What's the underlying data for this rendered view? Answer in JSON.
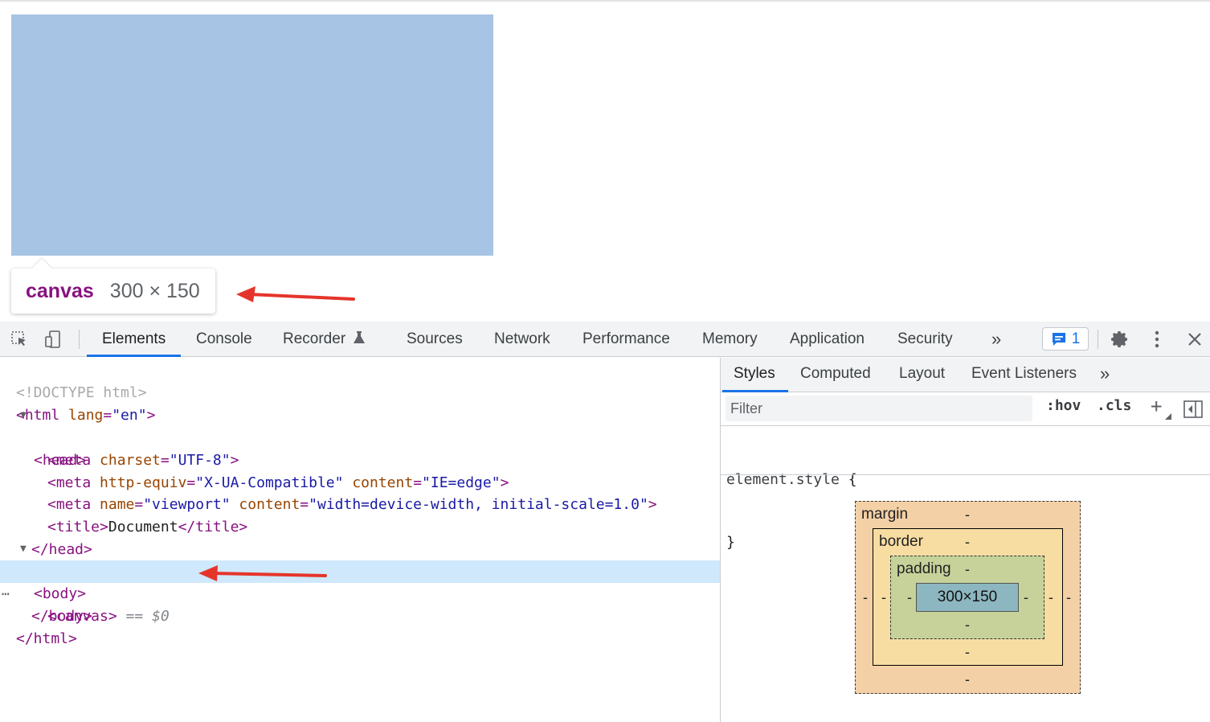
{
  "page": {
    "canvas_tooltip": {
      "tag": "canvas",
      "size": "300 × 150"
    },
    "colors": {
      "canvas_fill": "#a7c4e4",
      "annotation_arrow": "#e5352b",
      "tag_purple": "#881280"
    }
  },
  "toolbar": {
    "icons": [
      "inspect-element-icon",
      "device-toolbar-icon",
      "recorder-flask-icon",
      "more-tabs-icon",
      "issues-chat-icon",
      "gear-icon",
      "kebab-menu-icon",
      "close-icon"
    ],
    "tabs": [
      "Elements",
      "Console",
      "Recorder",
      "Sources",
      "Network",
      "Performance",
      "Memory",
      "Application",
      "Security"
    ],
    "more_tabs": "»",
    "active_tab": "Elements",
    "issues_count": "1",
    "close": "✕"
  },
  "dom": {
    "doctype": "<!DOCTYPE html>",
    "html_open": {
      "tag": "<html",
      "attr": " lang",
      "eq": "=",
      "val": "\"en\"",
      "end": ">"
    },
    "head_open": "<head>",
    "meta1": {
      "tag": "<meta",
      "attr": " charset",
      "eq": "=",
      "val": "\"UTF-8\"",
      "end": ">"
    },
    "meta2": {
      "tag": "<meta",
      "attr1": " http-equiv",
      "eq": "=",
      "val1": "\"X-UA-Compatible\"",
      "attr2": " content",
      "val2": "\"IE=edge\"",
      "end": ">"
    },
    "meta3": {
      "tag": "<meta",
      "attr1": " name",
      "eq": "=",
      "val1": "\"viewport\"",
      "attr2": " content",
      "val2": "\"width=device-width, initial-scale=1.0\"",
      "end": ">"
    },
    "title": {
      "open": "<title>",
      "text": "Document",
      "close": "</title>"
    },
    "head_close": "</head>",
    "body_open": "<body>",
    "canvas": {
      "tag": "<canvas>",
      "eq": " == ",
      "ref": "$0"
    },
    "body_close": "</body>",
    "html_close": "</html>",
    "ellipsis": "⋯"
  },
  "sidebar": {
    "tabs": [
      "Styles",
      "Computed",
      "Layout",
      "Event Listeners"
    ],
    "more_tabs": "»",
    "active_tab": "Styles",
    "filter_placeholder": "Filter",
    "hov": ":hov",
    "cls": ".cls",
    "add": "+",
    "element_style_selector": "element.style",
    "open_brace": "{",
    "close_brace": "}"
  },
  "box_model": {
    "margin_label": "margin",
    "border_label": "border",
    "padding_label": "padding",
    "content": "300×150",
    "dash": "-"
  }
}
